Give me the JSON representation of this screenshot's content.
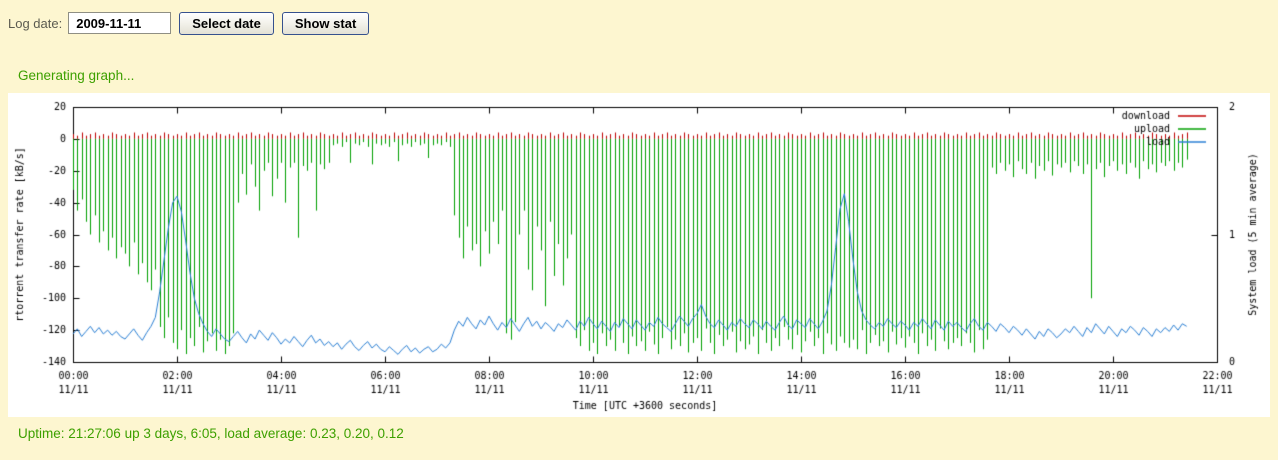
{
  "page": {
    "background": "#fdf6d0",
    "form": {
      "label": "Log date:",
      "date_value": "2009-11-11",
      "select_date_button": "Select date",
      "show_stat_button": "Show stat"
    },
    "status_generating": "Generating graph...",
    "status_uptime": "Uptime: 21:27:06 up 3 days, 6:05, load average: 0.23, 0.20, 0.12",
    "status_color": "#3da000"
  },
  "chart_data": {
    "type": "line",
    "title": "",
    "xlabel": "Time [UTC +3600 seconds]",
    "ylabel": "rtorrent transfer rate [kB/s]",
    "y2label": "System load (5 min average)",
    "xlim_hours": [
      0,
      22
    ],
    "ylim": [
      -140,
      20
    ],
    "y2lim": [
      0,
      2
    ],
    "grid": false,
    "legend_position": "top-right-inside",
    "background": "#ffffff",
    "frame_color": "#000000",
    "y_ticks": [
      20,
      0,
      -20,
      -40,
      -60,
      -80,
      -100,
      -120,
      -140
    ],
    "y2_ticks": [
      2,
      1,
      0
    ],
    "x_tick_labels": [
      {
        "time": "00:00",
        "date": "11/11"
      },
      {
        "time": "02:00",
        "date": "11/11"
      },
      {
        "time": "04:00",
        "date": "11/11"
      },
      {
        "time": "06:00",
        "date": "11/11"
      },
      {
        "time": "08:00",
        "date": "11/11"
      },
      {
        "time": "10:00",
        "date": "11/11"
      },
      {
        "time": "12:00",
        "date": "11/11"
      },
      {
        "time": "14:00",
        "date": "11/11"
      },
      {
        "time": "16:00",
        "date": "11/11"
      },
      {
        "time": "18:00",
        "date": "11/11"
      },
      {
        "time": "20:00",
        "date": "11/11"
      },
      {
        "time": "22:00",
        "date": "11/11"
      }
    ],
    "sample_interval_minutes": 5,
    "start_time": "00:00",
    "end_time": "21:25",
    "note": "download drawn as small positive impulses at the zero line; upload drawn as negative impulses; load drawn as line on right axis",
    "legend": [
      {
        "name": "download",
        "color": "#c00000"
      },
      {
        "name": "upload",
        "color": "#00a000"
      },
      {
        "name": "load",
        "color": "#2a7fd4"
      }
    ],
    "series": [
      {
        "name": "download",
        "axis": "left",
        "style": "impulses",
        "color": "#c00000",
        "values": [
          3,
          2,
          4,
          2,
          3,
          4,
          2,
          3,
          2,
          4,
          3,
          2,
          3,
          2,
          4,
          2,
          3,
          4,
          2,
          3,
          2,
          4,
          3,
          2,
          3,
          2,
          4,
          2,
          3,
          4,
          2,
          3,
          2,
          4,
          3,
          2,
          3,
          2,
          4,
          2,
          3,
          4,
          2,
          3,
          2,
          4,
          3,
          2,
          3,
          2,
          4,
          2,
          3,
          4,
          2,
          3,
          2,
          4,
          3,
          2,
          3,
          2,
          4,
          2,
          3,
          4,
          2,
          3,
          2,
          4,
          3,
          2,
          3,
          2,
          4,
          2,
          3,
          4,
          2,
          3,
          2,
          4,
          3,
          2,
          3,
          2,
          4,
          2,
          3,
          4,
          2,
          3,
          2,
          4,
          3,
          2,
          3,
          2,
          4,
          2,
          3,
          4,
          2,
          3,
          2,
          4,
          3,
          2,
          3,
          2,
          4,
          2,
          3,
          4,
          2,
          3,
          2,
          4,
          3,
          2,
          3,
          2,
          4,
          2,
          3,
          4,
          2,
          3,
          2,
          4,
          3,
          2,
          3,
          2,
          4,
          2,
          3,
          4,
          2,
          3,
          2,
          4,
          3,
          2,
          3,
          2,
          4,
          2,
          3,
          4,
          2,
          3,
          2,
          4,
          3,
          2,
          3,
          2,
          4,
          2,
          3,
          4,
          2,
          3,
          2,
          4,
          3,
          2,
          3,
          2,
          4,
          2,
          3,
          4,
          2,
          3,
          2,
          4,
          3,
          2,
          3,
          2,
          4,
          2,
          3,
          4,
          2,
          3,
          2,
          4,
          3,
          2,
          3,
          2,
          4,
          2,
          3,
          4,
          2,
          3,
          2,
          4,
          3,
          2,
          3,
          2,
          4,
          2,
          3,
          4,
          2,
          3,
          2,
          4,
          3,
          2,
          3,
          2,
          4,
          2,
          3,
          4,
          2,
          3,
          2,
          4,
          3,
          2,
          3,
          2,
          4,
          2,
          3,
          4,
          2,
          3,
          2,
          4,
          3,
          2,
          3,
          2,
          4,
          2,
          3,
          4,
          2,
          3,
          2,
          4,
          3,
          2,
          3,
          2,
          4,
          2,
          3,
          4
        ]
      },
      {
        "name": "upload",
        "axis": "left",
        "style": "impulses",
        "color": "#00a000",
        "values": [
          -32,
          -45,
          -38,
          -52,
          -60,
          -48,
          -65,
          -58,
          -70,
          -62,
          -75,
          -68,
          -72,
          -80,
          -65,
          -85,
          -78,
          -90,
          -95,
          -82,
          -118,
          -125,
          -112,
          -128,
          -132,
          -120,
          -135,
          -125,
          -130,
          -118,
          -134,
          -127,
          -122,
          -133,
          -126,
          -135,
          -130,
          -122,
          -40,
          -22,
          -35,
          -16,
          -30,
          -45,
          -20,
          -15,
          -36,
          -25,
          -15,
          -40,
          -18,
          -15,
          -62,
          -17,
          -20,
          -15,
          -45,
          -16,
          -19,
          -15,
          -4,
          -3,
          -5,
          -2,
          -15,
          -3,
          -4,
          -2,
          -5,
          -16,
          -3,
          -4,
          -3,
          -5,
          -2,
          -14,
          -4,
          -3,
          -5,
          -2,
          -4,
          -3,
          -12,
          -4,
          -3,
          -4,
          -2,
          -5,
          -48,
          -62,
          -75,
          -55,
          -70,
          -66,
          -80,
          -58,
          -72,
          -52,
          -66,
          -45,
          -122,
          -126,
          -115,
          -60,
          -45,
          -82,
          -95,
          -55,
          -70,
          -105,
          -52,
          -86,
          -66,
          -92,
          -75,
          -60,
          -125,
          -130,
          -120,
          -133,
          -128,
          -135,
          -122,
          -130,
          -126,
          -133,
          -118,
          -128,
          -135,
          -124,
          -130,
          -127,
          -133,
          -121,
          -129,
          -135,
          -125,
          -118,
          -132,
          -126,
          -130,
          -122,
          -134,
          -128,
          -125,
          -133,
          -119,
          -128,
          -135,
          -123,
          -130,
          -126,
          -121,
          -134,
          -127,
          -132,
          -129,
          -124,
          -135,
          -120,
          -128,
          -133,
          -125,
          -130,
          -118,
          -126,
          -132,
          -123,
          -134,
          -127,
          -121,
          -130,
          -125,
          -135,
          -122,
          -129,
          -133,
          -124,
          -128,
          -131,
          -126,
          -132,
          -120,
          -135,
          -128,
          -123,
          -130,
          -127,
          -134,
          -121,
          -129,
          -125,
          -131,
          -124,
          -128,
          -135,
          -122,
          -130,
          -126,
          -133,
          -119,
          -127,
          -132,
          -128,
          -125,
          -130,
          -122,
          -128,
          -134,
          -120,
          -132,
          -126,
          -18,
          -22,
          -15,
          -20,
          -16,
          -24,
          -14,
          -19,
          -22,
          -15,
          -25,
          -17,
          -20,
          -14,
          -23,
          -16,
          -18,
          -15,
          -21,
          -14,
          -17,
          -22,
          -16,
          -100,
          -19,
          -15,
          -24,
          -17,
          -14,
          -20,
          -16,
          -22,
          -15,
          -18,
          -25,
          -14,
          -19,
          -16,
          -21,
          -15,
          -17,
          -14,
          -20,
          -15,
          -18,
          -13
        ]
      },
      {
        "name": "load",
        "axis": "right",
        "style": "line",
        "color": "#2a7fd4",
        "values": [
          0.22,
          0.26,
          0.2,
          0.24,
          0.28,
          0.23,
          0.27,
          0.22,
          0.25,
          0.21,
          0.24,
          0.2,
          0.18,
          0.22,
          0.26,
          0.21,
          0.17,
          0.23,
          0.28,
          0.35,
          0.55,
          0.8,
          1.05,
          1.25,
          1.3,
          1.18,
          0.95,
          0.7,
          0.5,
          0.38,
          0.3,
          0.24,
          0.2,
          0.26,
          0.22,
          0.18,
          0.16,
          0.2,
          0.24,
          0.19,
          0.15,
          0.22,
          0.18,
          0.25,
          0.21,
          0.17,
          0.23,
          0.19,
          0.14,
          0.18,
          0.15,
          0.2,
          0.16,
          0.12,
          0.17,
          0.21,
          0.15,
          0.18,
          0.13,
          0.16,
          0.12,
          0.15,
          0.1,
          0.14,
          0.17,
          0.12,
          0.09,
          0.13,
          0.16,
          0.11,
          0.14,
          0.1,
          0.08,
          0.12,
          0.09,
          0.06,
          0.1,
          0.13,
          0.08,
          0.11,
          0.07,
          0.1,
          0.12,
          0.08,
          0.1,
          0.14,
          0.11,
          0.15,
          0.25,
          0.32,
          0.28,
          0.35,
          0.3,
          0.26,
          0.33,
          0.29,
          0.36,
          0.3,
          0.25,
          0.31,
          0.27,
          0.34,
          0.29,
          0.24,
          0.3,
          0.35,
          0.28,
          0.32,
          0.26,
          0.31,
          0.28,
          0.24,
          0.3,
          0.27,
          0.33,
          0.29,
          0.25,
          0.32,
          0.28,
          0.35,
          0.3,
          0.26,
          0.32,
          0.28,
          0.24,
          0.31,
          0.27,
          0.34,
          0.3,
          0.26,
          0.33,
          0.29,
          0.25,
          0.31,
          0.28,
          0.35,
          0.3,
          0.27,
          0.24,
          0.3,
          0.36,
          0.32,
          0.28,
          0.34,
          0.38,
          0.45,
          0.36,
          0.3,
          0.27,
          0.33,
          0.29,
          0.25,
          0.31,
          0.28,
          0.34,
          0.3,
          0.27,
          0.33,
          0.3,
          0.26,
          0.32,
          0.28,
          0.25,
          0.31,
          0.36,
          0.29,
          0.26,
          0.33,
          0.3,
          0.27,
          0.34,
          0.3,
          0.26,
          0.32,
          0.4,
          0.6,
          0.9,
          1.2,
          1.32,
          1.1,
          0.8,
          0.55,
          0.4,
          0.33,
          0.29,
          0.26,
          0.31,
          0.28,
          0.34,
          0.3,
          0.27,
          0.32,
          0.29,
          0.25,
          0.31,
          0.28,
          0.34,
          0.3,
          0.26,
          0.33,
          0.29,
          0.25,
          0.32,
          0.28,
          0.31,
          0.27,
          0.24,
          0.3,
          0.34,
          0.28,
          0.25,
          0.31,
          0.28,
          0.24,
          0.3,
          0.27,
          0.23,
          0.28,
          0.25,
          0.21,
          0.26,
          0.22,
          0.18,
          0.24,
          0.2,
          0.26,
          0.23,
          0.19,
          0.22,
          0.26,
          0.23,
          0.28,
          0.24,
          0.2,
          0.27,
          0.23,
          0.3,
          0.26,
          0.22,
          0.28,
          0.24,
          0.2,
          0.26,
          0.23,
          0.28,
          0.25,
          0.21,
          0.27,
          0.24,
          0.2,
          0.26,
          0.23,
          0.27,
          0.24,
          0.29,
          0.25,
          0.3,
          0.28
        ]
      }
    ]
  }
}
